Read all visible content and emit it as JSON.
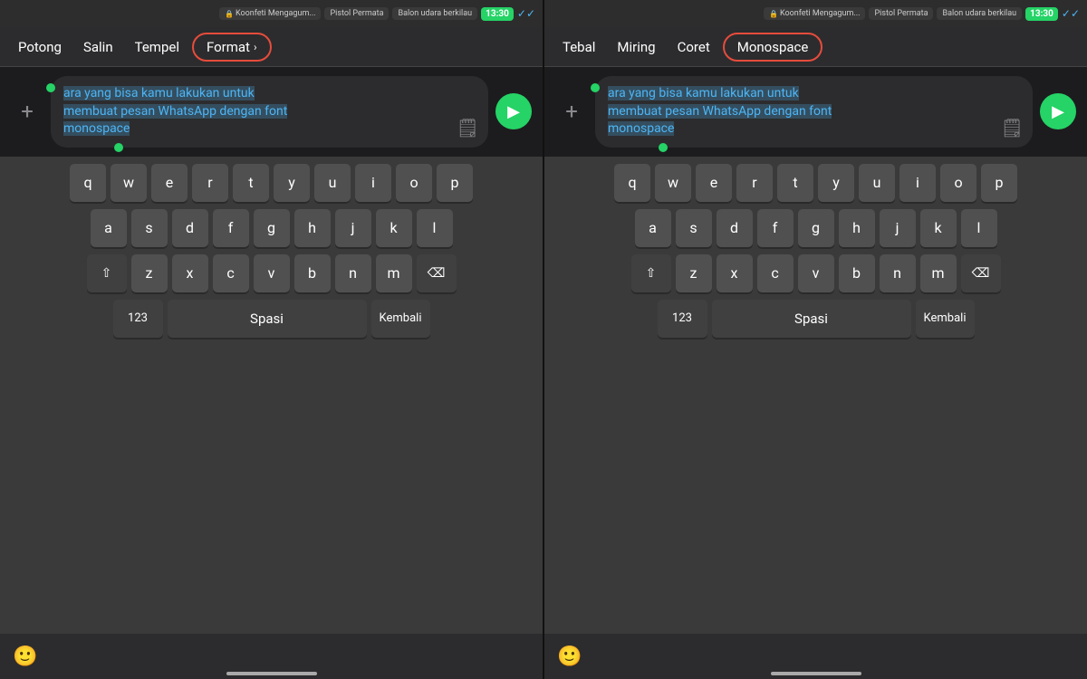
{
  "left_panel": {
    "status_bar": {
      "tabs": [
        {
          "label": "Koonfeti Mengagum...",
          "has_lock": true
        },
        {
          "label": "Pistol Permata",
          "has_lock": false
        },
        {
          "label": "Balon udara berkilau",
          "has_lock": false
        }
      ],
      "time": "13:30",
      "ticks": "✓✓"
    },
    "context_menu": {
      "items": [
        "Potong",
        "Salin",
        "Tempel"
      ],
      "format_label": "Format",
      "format_chevron": "›"
    },
    "message_text_line1": "ara yang bisa kamu lakukan untuk",
    "message_text_line2": "membuat pesan WhatsApp dengan font",
    "message_text_line3": "monospace",
    "keyboard": {
      "row1": [
        "q",
        "w",
        "e",
        "r",
        "t",
        "y",
        "u",
        "i",
        "o",
        "p"
      ],
      "row2": [
        "a",
        "s",
        "d",
        "f",
        "g",
        "h",
        "j",
        "k",
        "l"
      ],
      "row3": [
        "z",
        "x",
        "c",
        "v",
        "b",
        "n",
        "m"
      ],
      "bottom": {
        "num_label": "123",
        "space_label": "Spasi",
        "done_label": "Kembali"
      }
    },
    "emoji_icon": "🙂"
  },
  "right_panel": {
    "status_bar": {
      "tabs": [
        {
          "label": "Koonfeti Mengagum...",
          "has_lock": true
        },
        {
          "label": "Pistol Permata",
          "has_lock": false
        },
        {
          "label": "Balon udara berkilau",
          "has_lock": false
        }
      ],
      "time": "13:30",
      "ticks": "✓✓"
    },
    "context_menu": {
      "items": [
        "Tebal",
        "Miring",
        "Coret"
      ],
      "monospace_label": "Monospace"
    },
    "message_text_line1": "ara yang bisa kamu lakukan untuk",
    "message_text_line2": "membuat pesan WhatsApp dengan font",
    "message_text_line3": "monospace",
    "keyboard": {
      "row1": [
        "q",
        "w",
        "e",
        "r",
        "t",
        "y",
        "u",
        "i",
        "o",
        "p"
      ],
      "row2": [
        "a",
        "s",
        "d",
        "f",
        "g",
        "h",
        "j",
        "k",
        "l"
      ],
      "row3": [
        "z",
        "x",
        "c",
        "v",
        "b",
        "n",
        "m"
      ],
      "bottom": {
        "num_label": "123",
        "space_label": "Spasi",
        "done_label": "Kembali"
      }
    },
    "emoji_icon": "🙂"
  },
  "colors": {
    "accent_green": "#25D366",
    "accent_red": "#e74c3c",
    "text_blue": "#4db5f5",
    "key_bg": "#505050",
    "special_key_bg": "#404040",
    "menu_bg": "#2c2c2e"
  }
}
